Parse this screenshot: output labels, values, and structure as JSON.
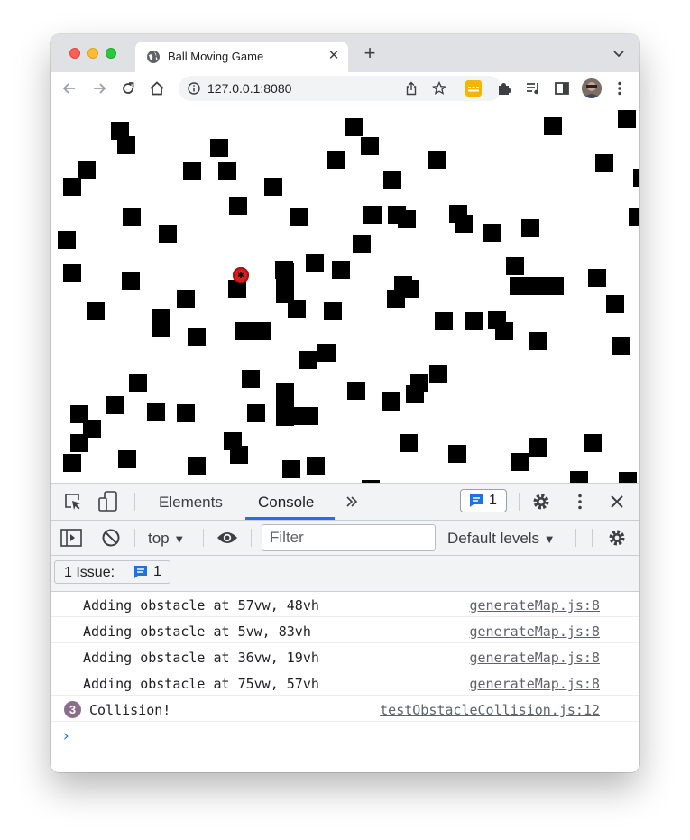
{
  "browser": {
    "tab": {
      "title": "Ball Moving Game",
      "close_icon": "close-icon",
      "favicon": "globe-icon"
    },
    "new_tab_icon": "plus-icon",
    "tab_search_icon": "chevron-down-icon",
    "toolbar": {
      "back_icon": "arrow-left-icon",
      "forward_icon": "arrow-right-icon",
      "reload_icon": "reload-icon",
      "home_icon": "home-icon",
      "url": "127.0.0.1:8080",
      "site_info_icon": "info-icon",
      "share_icon": "share-icon",
      "bookmark_icon": "star-icon",
      "extension_icons": [
        "keyboard-extension-icon",
        "puzzle-icon",
        "media-icon",
        "side-panel-icon"
      ],
      "menu_icon": "kebab-menu-icon"
    },
    "colors": {
      "tabstrip": "#dfe1e5",
      "omnibox": "#f1f3f4",
      "close_dot": "#ff5f57",
      "minimize_dot": "#febc2e",
      "zoom_dot": "#28c840"
    }
  },
  "game": {
    "ball_color": "#d81e1e",
    "obstacle_color": "#000000"
  },
  "devtools": {
    "tabs": [
      {
        "label": "Elements",
        "active": false
      },
      {
        "label": "Console",
        "active": true
      }
    ],
    "more_tabs_icon": "double-chevron-right-icon",
    "message_count": "1",
    "settings_icon": "gear-icon",
    "menu_icon": "kebab-menu-icon",
    "close_icon": "close-icon",
    "console_toolbar": {
      "context": "top",
      "filter_placeholder": "Filter",
      "levels": "Default levels"
    },
    "issues": {
      "label": "1 Issue:",
      "count": "1"
    },
    "log": [
      {
        "text": "Adding obstacle at 57vw, 48vh",
        "source": "generateMap.js:8"
      },
      {
        "text": "Adding obstacle at 5vw, 83vh",
        "source": "generateMap.js:8"
      },
      {
        "text": "Adding obstacle at 36vw, 19vh",
        "source": "generateMap.js:8"
      },
      {
        "text": "Adding obstacle at 75vw, 57vh",
        "source": "generateMap.js:8"
      },
      {
        "text": "Collision!",
        "source": "testObstacleCollision.js:12",
        "repeat": "3"
      }
    ],
    "prompt": "›"
  }
}
